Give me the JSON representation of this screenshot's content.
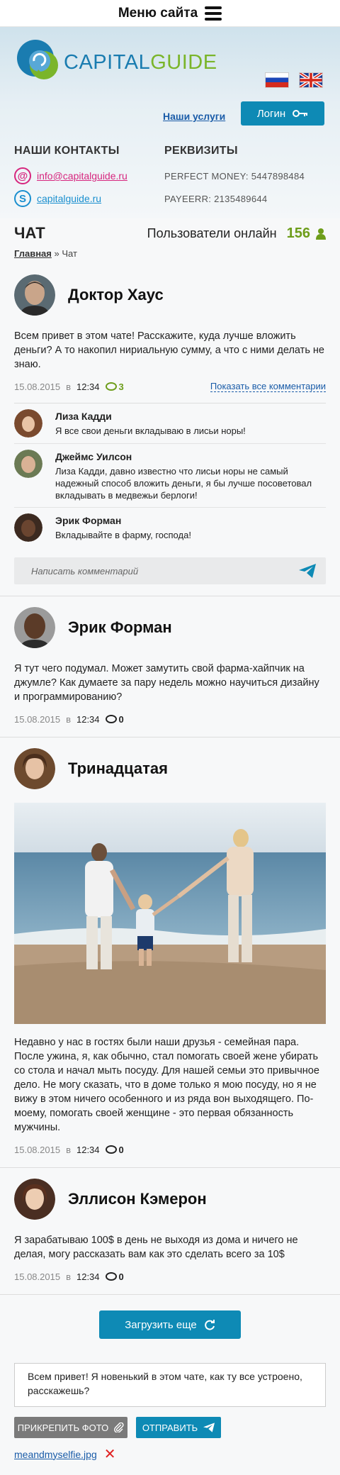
{
  "topbar": {
    "menu_title": "Меню сайта"
  },
  "header": {
    "logo_part1": "CAPITAL",
    "logo_part2": "GUIDE",
    "services_link": "Наши услуги",
    "login_label": "Логин",
    "languages": [
      "ru",
      "en"
    ]
  },
  "contacts": {
    "title": "НАШИ КОНТАКТЫ",
    "email": "info@capitalguide.ru",
    "skype": "capitalguide.ru"
  },
  "requisites": {
    "title": "РЕКВИЗИТЫ",
    "items": [
      "PERFECT MONEY: 5447898484",
      "PAYEERR: 2135489644"
    ]
  },
  "chat": {
    "title": "ЧАТ",
    "online_label": "Пользователи онлайн",
    "online_count": "156",
    "breadcrumb_home": "Главная",
    "breadcrumb_sep": "»",
    "breadcrumb_current": "Чат"
  },
  "posts": [
    {
      "author": "Доктор Хаус",
      "text": "Всем привет в этом чате! Расскажите, куда лучше вложить деньги? А то накопил нириальную сумму, а что с ними делать не знаю.",
      "date": "15.08.2015",
      "at": "в",
      "time": "12:34",
      "comments": "3",
      "show_all": "Показать все комментарии",
      "comment_list": [
        {
          "name": "Лиза Кадди",
          "text": "Я все свои деньги вкладываю в лисьи норы!"
        },
        {
          "name": "Джеймс Уилсон",
          "text": "Лиза Кадди, давно известно что лисьи норы не самый надежный способ вложить деньги, я бы лучше посоветовал вкладывать в медвежьи берлоги!"
        },
        {
          "name": "Эрик Форман",
          "text": "Вкладывайте в фарму, господа!"
        }
      ],
      "comment_placeholder": "Написать комментарий"
    },
    {
      "author": "Эрик Форман",
      "text": "Я тут чего подумал. Может замутить свой фарма-хайпчик на джумле? Как думаете за пару недель можно научиться дизайну и программированию?",
      "date": "15.08.2015",
      "at": "в",
      "time": "12:34",
      "comments": "0"
    },
    {
      "author": "Тринадцатая",
      "text": "Недавно у нас в гостях были наши друзья - семейная пара. После ужина, я, как обычно, стал помогать своей жене убирать со стола и начал мыть посуду. Для нашей семьи это привычное дело. Не могу сказать, что в доме только я мою посуду, но я не вижу в этом ничего особенного и из ряда вон выходящего. По-моему, помогать своей женщине - это первая обязанность мужчины.",
      "date": "15.08.2015",
      "at": "в",
      "time": "12:34",
      "comments": "0"
    },
    {
      "author": "Эллисон Кэмерон",
      "text": "Я зарабатываю 100$ в день не выходя из дома и ничего не делая, могу рассказать вам как это сделать всего за 10$",
      "date": "15.08.2015",
      "at": "в",
      "time": "12:34",
      "comments": "0"
    }
  ],
  "load_more": "Загрузить еще",
  "compose": {
    "text": "Всем привет! Я новенький в этом чате, как ту все устроено, расскажешь?",
    "attach_label": "ПРИКРЕПИТЬ ФОТО",
    "send_label": "ОТПРАВИТЬ",
    "attached_file": "meandmyselfie.jpg"
  },
  "colors": {
    "accent": "#0e8ab5",
    "green": "#6d9d1a",
    "link": "#1a5ca8"
  }
}
